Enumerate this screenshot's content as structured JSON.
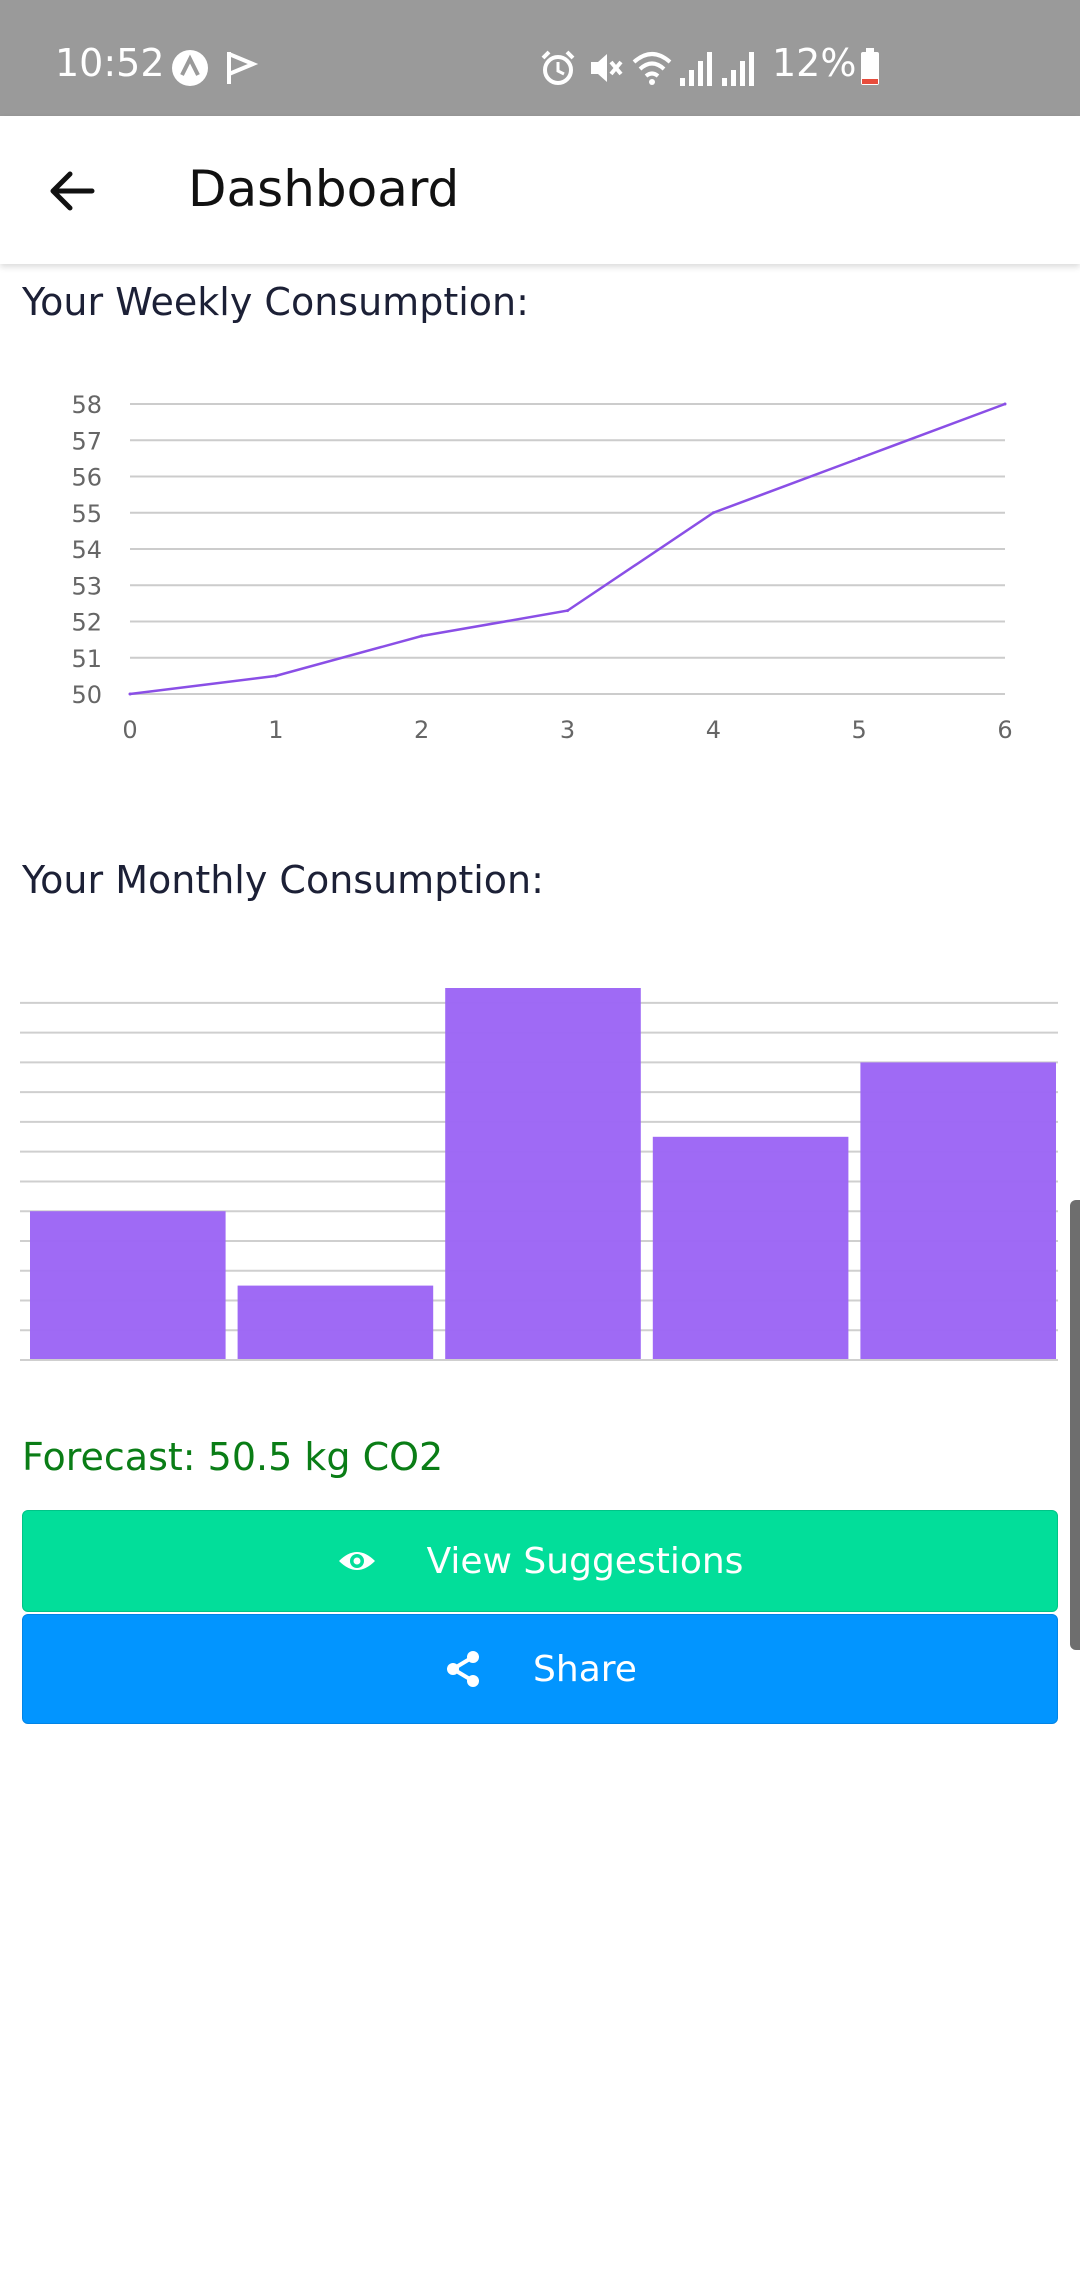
{
  "status_bar": {
    "time": "10:52",
    "battery": "12%",
    "icons": [
      "app-a-icon",
      "app-flag-icon",
      "alarm-icon",
      "mute-icon",
      "wifi-icon",
      "signal-icon",
      "signal-icon",
      "battery-icon"
    ]
  },
  "app_bar": {
    "title": "Dashboard",
    "back_icon": "arrow-left-icon"
  },
  "weekly": {
    "title": "Your Weekly Consumption:"
  },
  "monthly": {
    "title": "Your Monthly Consumption:"
  },
  "chart_data": [
    {
      "type": "line",
      "x": [
        0,
        1,
        2,
        3,
        4,
        5,
        6
      ],
      "y_ticks": [
        50,
        51,
        52,
        53,
        54,
        55,
        56,
        57,
        58
      ],
      "x_ticks": [
        0,
        1,
        2,
        3,
        4,
        5,
        6
      ],
      "series": [
        {
          "values": [
            50,
            50.5,
            51.6,
            52.3,
            55,
            56.5,
            58
          ]
        }
      ],
      "ylim": [
        50,
        58
      ],
      "xlim": [
        0,
        6
      ],
      "grid": true,
      "color": "#8a4fe6"
    },
    {
      "type": "bar",
      "values": [
        5,
        2.5,
        12.5,
        7.5,
        10
      ],
      "ylim": [
        0,
        12.5
      ],
      "grid": true,
      "color": "#9d67f5"
    }
  ],
  "forecast": {
    "text": "Forecast: 50.5 kg CO2",
    "color": "#0a7d16"
  },
  "buttons": {
    "suggestions": {
      "label": "View Suggestions",
      "icon": "eye-icon",
      "color": "#02de9a"
    },
    "share": {
      "label": "Share",
      "icon": "share-icon",
      "color": "#0295ff"
    }
  }
}
